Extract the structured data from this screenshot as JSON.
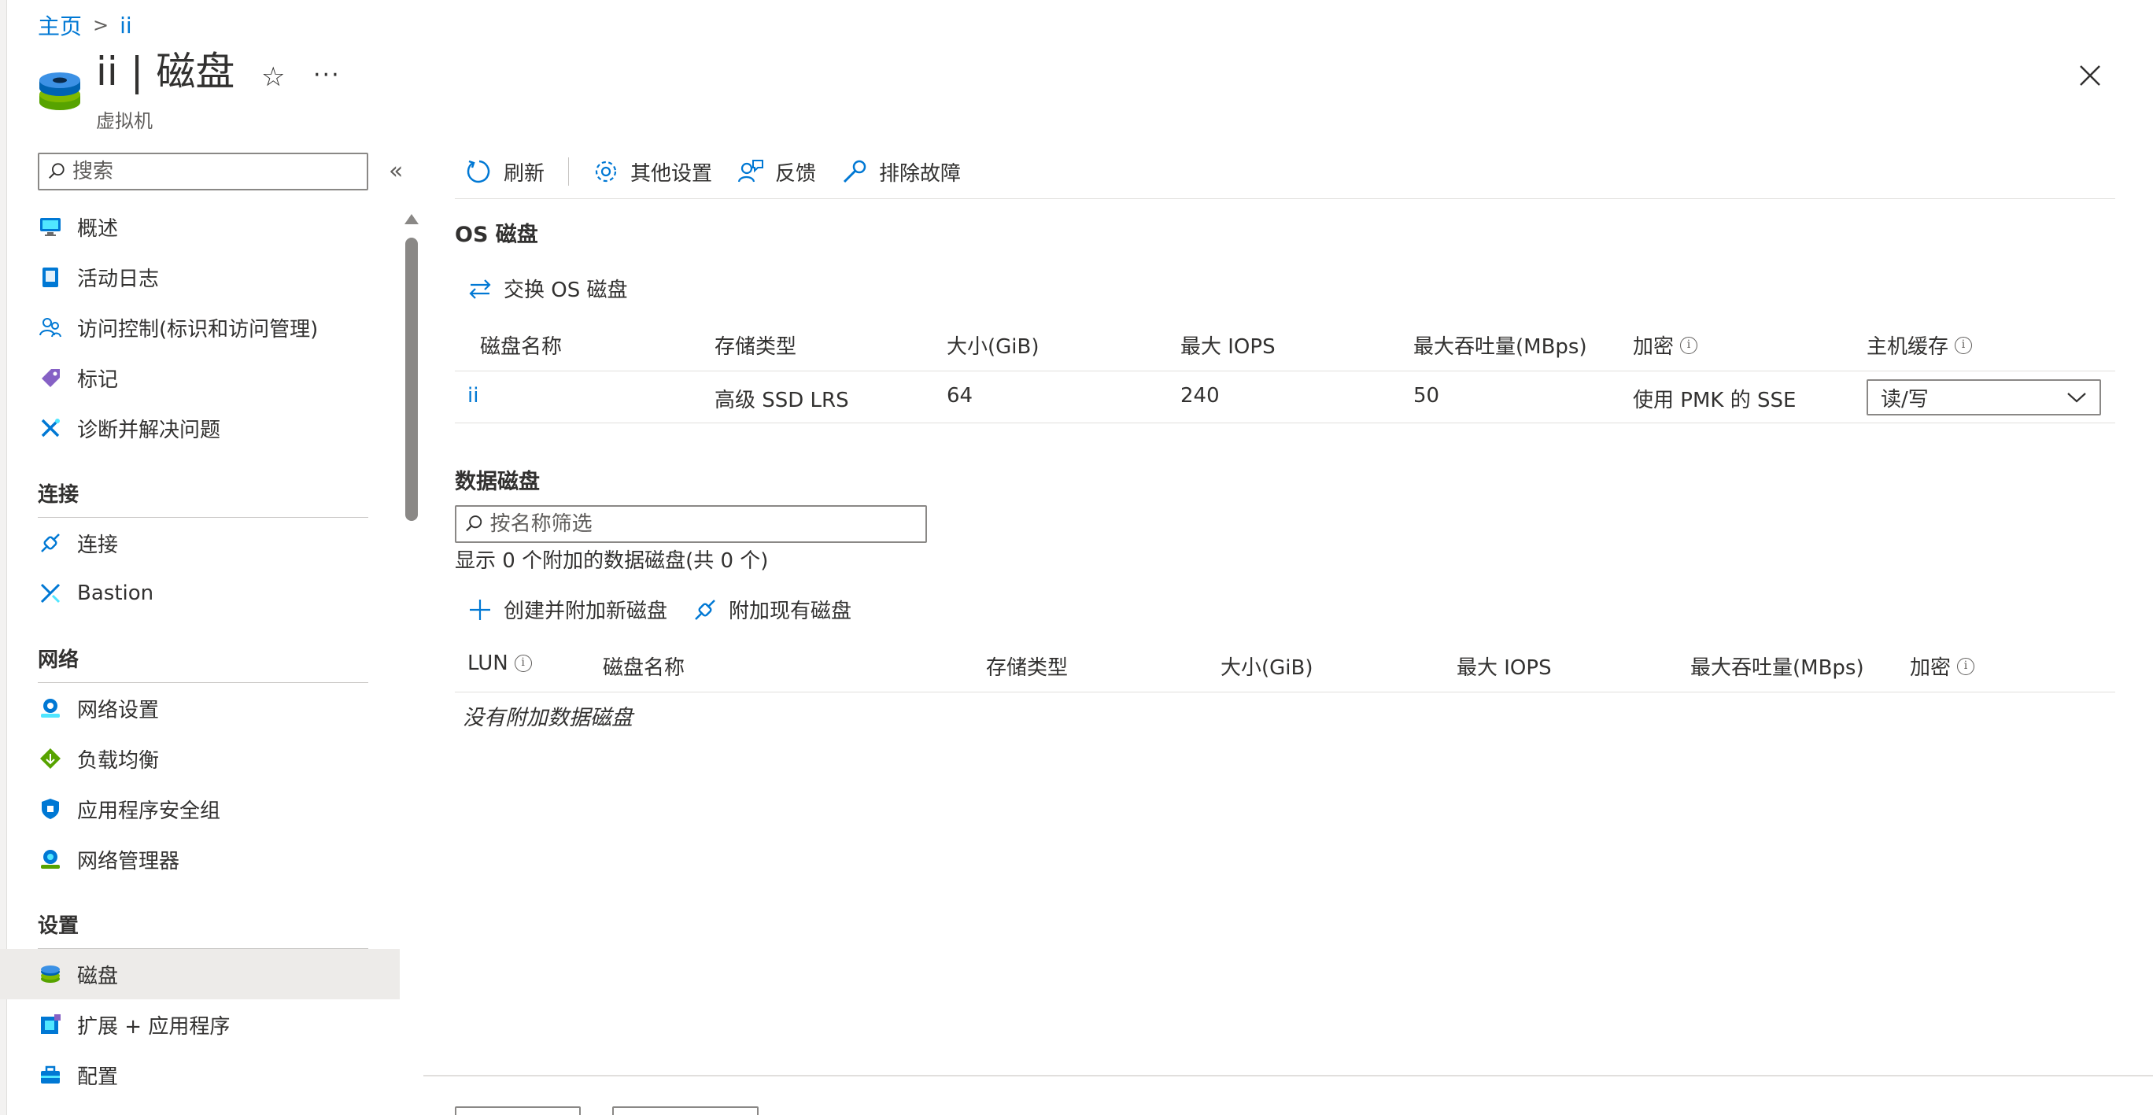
{
  "breadcrumb": {
    "home": "主页",
    "separator": ">",
    "current": "ii"
  },
  "header": {
    "title": "ii | 磁盘",
    "subtitle": "虚拟机",
    "favorite_icon": "☆",
    "more_icon": "···"
  },
  "sidebar": {
    "search_placeholder": "搜索",
    "collapse_icon": "«",
    "items_top": [
      {
        "label": "概述",
        "icon": "monitor-icon"
      },
      {
        "label": "活动日志",
        "icon": "log-icon"
      },
      {
        "label": "访问控制(标识和访问管理)",
        "icon": "people-icon"
      },
      {
        "label": "标记",
        "icon": "tag-icon"
      },
      {
        "label": "诊断并解决问题",
        "icon": "wrench-icon"
      }
    ],
    "groups": [
      {
        "title": "连接",
        "items": [
          {
            "label": "连接",
            "icon": "plug-icon"
          },
          {
            "label": "Bastion",
            "icon": "bastion-icon"
          }
        ]
      },
      {
        "title": "网络",
        "items": [
          {
            "label": "网络设置",
            "icon": "network-icon"
          },
          {
            "label": "负载均衡",
            "icon": "load-balancer-icon"
          },
          {
            "label": "应用程序安全组",
            "icon": "shield-icon"
          },
          {
            "label": "网络管理器",
            "icon": "network-manager-icon"
          }
        ]
      },
      {
        "title": "设置",
        "items": [
          {
            "label": "磁盘",
            "icon": "disk-icon",
            "active": true
          },
          {
            "label": "扩展 + 应用程序",
            "icon": "extension-icon"
          },
          {
            "label": "配置",
            "icon": "toolbox-icon"
          }
        ]
      }
    ]
  },
  "toolbar": {
    "refresh": "刷新",
    "other_settings": "其他设置",
    "feedback": "反馈",
    "troubleshoot": "排除故障"
  },
  "os_disk": {
    "section_title": "OS 磁盘",
    "swap_label": "交换 OS 磁盘",
    "columns": [
      "磁盘名称",
      "存储类型",
      "大小(GiB)",
      "最大 IOPS",
      "最大吞吐量(MBps)",
      "加密",
      "主机缓存"
    ],
    "row": {
      "name": "ii",
      "storage_type": "高级 SSD LRS",
      "size": "64",
      "max_iops": "240",
      "max_throughput": "50",
      "encryption": "使用 PMK 的 SSE",
      "host_cache": "读/写"
    }
  },
  "data_disks": {
    "section_title": "数据磁盘",
    "filter_placeholder": "按名称筛选",
    "count_text": "显示 0 个附加的数据磁盘(共 0 个)",
    "create_label": "创建并附加新磁盘",
    "attach_label": "附加现有磁盘",
    "columns": [
      "LUN",
      "磁盘名称",
      "存储类型",
      "大小(GiB)",
      "最大 IOPS",
      "最大吞吐量(MBps)",
      "加密"
    ],
    "empty_text": "没有附加数据磁盘"
  },
  "colors": {
    "accent": "#0078d4",
    "text": "#323130",
    "border": "#8a8886",
    "active_bg": "#edebe9"
  }
}
